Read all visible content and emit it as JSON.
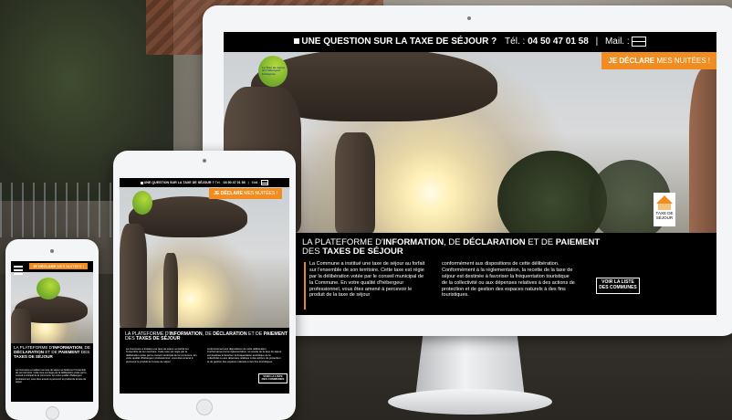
{
  "site": {
    "question": "UNE QUESTION SUR LA TAXE DE SÉJOUR ?",
    "tel_label": "Tél. :",
    "phone": "04 50 47 01 58",
    "divider": "|",
    "mail_label": "Mail. :",
    "cta_strong": "JE DÉCLARE",
    "cta_rest": "MES NUITÉES !",
    "title_p1": "LA PLATEFORME D'",
    "title_b1": "INFORMATION",
    "title_p2": ", DE ",
    "title_b2": "DÉCLARATION",
    "title_p3": " ET DE ",
    "title_b3": "PAIEMENT",
    "title_p4": "DES ",
    "title_b4": "TAXES DE SÉJOUR",
    "col1": "La Commune a institué une taxe de séjour au forfait sur l'ensemble de son territoire. Cette taxe est régie par la délibération votée par le conseil municipal de la Commune. En votre qualité d'hébergeur professionnel, vous êtes amené à percevoir le produit de la taxe de séjour",
    "col2": "conformément aux dispositions de cette délibération. Conformément à la réglementation, la recette de la taxe de séjour est destinée à favoriser la fréquentation touristique de la collectivité ou aux dépenses relatives à des actions de protection et de gestion des espaces naturels à des fins touristiques.",
    "list_btn_1": "VOIR LA LISTE",
    "list_btn_2": "DES COMMUNES",
    "badge_1": "TAXE DE",
    "badge_2": "SÉJOUR",
    "logo_1": "La Taxe de séjour",
    "logo_2": "de l'hébergeur",
    "logo_3": "Entreprise"
  },
  "colors": {
    "accent": "#f08c20",
    "bar": "#000000",
    "device": "#f4f5f6"
  }
}
